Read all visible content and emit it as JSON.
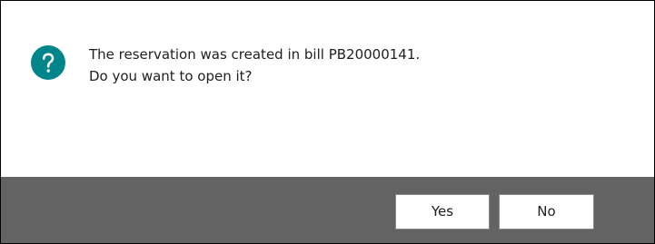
{
  "dialog": {
    "icon": "question-icon",
    "accent_color": "#00858a",
    "footer_color": "#636363",
    "message_line1": "The reservation was created in bill PB20000141.",
    "message_line2": "Do you want to open it?",
    "buttons": {
      "yes_label": "Yes",
      "no_label": "No"
    }
  }
}
